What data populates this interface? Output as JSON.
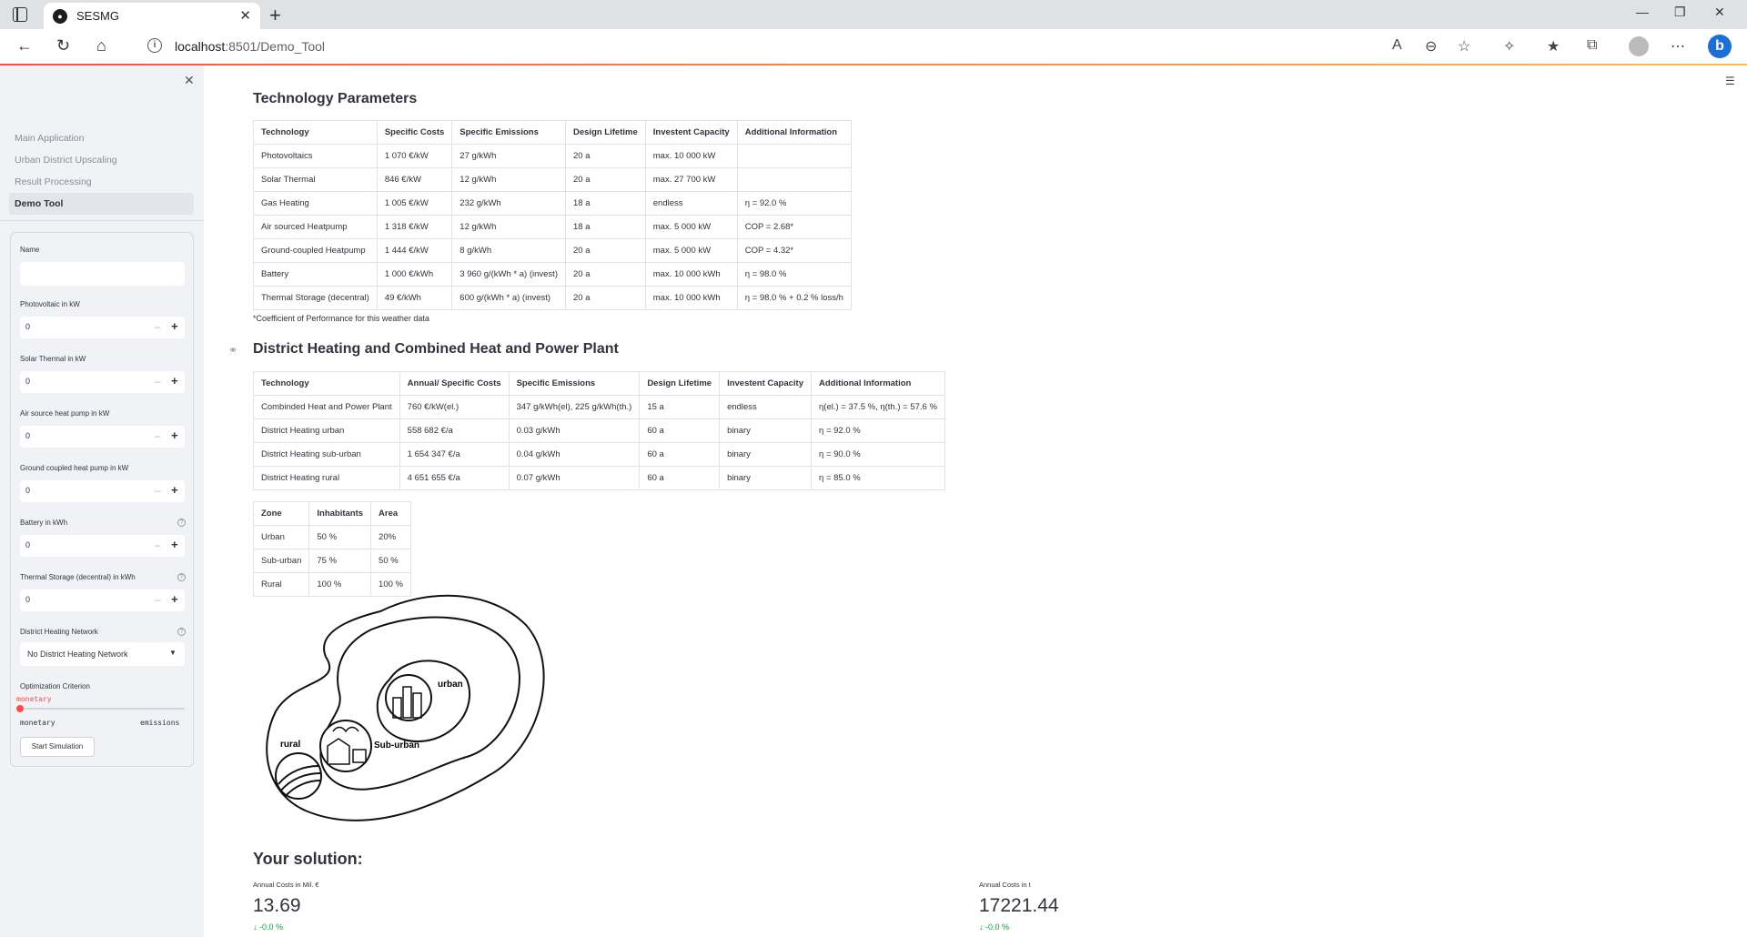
{
  "browser": {
    "tab_title": "SESMG",
    "url_host": "localhost",
    "url_rest": ":8501/Demo_Tool"
  },
  "sidebar": {
    "nav": [
      {
        "label": "Main Application"
      },
      {
        "label": "Urban District Upscaling"
      },
      {
        "label": "Result Processing"
      },
      {
        "label": "Demo Tool"
      }
    ],
    "form": {
      "name_label": "Name",
      "name_value": "",
      "pv_label": "Photovoltaic in kW",
      "pv_value": "0",
      "st_label": "Solar Thermal in kW",
      "st_value": "0",
      "ashp_label": "Air source heat pump in kW",
      "ashp_value": "0",
      "gchp_label": "Ground coupled heat pump in kW",
      "gchp_value": "0",
      "battery_label": "Battery in kWh",
      "battery_value": "0",
      "ts_label": "Thermal Storage (decentral) in kWh",
      "ts_value": "0",
      "dhn_label": "District Heating Network",
      "dhn_value": "No District Heating Network",
      "opt_label": "Optimization Criterion",
      "opt_value": "monetary",
      "opt_min": "monetary",
      "opt_max": "emissions",
      "opt_position": 0,
      "start_label": "Start Simulation"
    }
  },
  "main": {
    "tech_title": "Technology Parameters",
    "tech_table": {
      "headers": [
        "Technology",
        "Specific Costs",
        "Specific Emissions",
        "Design Lifetime",
        "Investent Capacity",
        "Additional Information"
      ],
      "rows": [
        [
          "Photovoltaics",
          "1 070 €/kW",
          "27 g/kWh",
          "20 a",
          "max. 10 000 kW",
          ""
        ],
        [
          "Solar Thermal",
          "846 €/kW",
          "12 g/kWh",
          "20 a",
          "max. 27 700 kW",
          ""
        ],
        [
          "Gas Heating",
          "1 005 €/kW",
          "232 g/kWh",
          "18 a",
          "endless",
          "η = 92.0 %"
        ],
        [
          "Air sourced Heatpump",
          "1 318 €/kW",
          "12 g/kWh",
          "18 a",
          "max. 5 000 kW",
          "COP = 2.68*"
        ],
        [
          "Ground-coupled Heatpump",
          "1 444 €/kW",
          "8 g/kWh",
          "20 a",
          "max. 5 000 kW",
          "COP = 4.32*"
        ],
        [
          "Battery",
          "1 000 €/kWh",
          "3 960 g/(kWh * a) (invest)",
          "20 a",
          "max. 10 000 kWh",
          "η = 98.0 %"
        ],
        [
          "Thermal Storage (decentral)",
          "49 €/kWh",
          "600 g/(kWh * a) (invest)",
          "20 a",
          "max. 10 000 kWh",
          "η = 98.0 % + 0.2 % loss/h"
        ]
      ]
    },
    "tech_footnote": "*Coefficient of Performance for this weather data",
    "dh_title": "District Heating and Combined Heat and Power Plant",
    "dh_table": {
      "headers": [
        "Technology",
        "Annual/ Specific Costs",
        "Specific Emissions",
        "Design Lifetime",
        "Investent Capacity",
        "Additional Information"
      ],
      "rows": [
        [
          "Combinded Heat and Power Plant",
          "760 €/kW(el.)",
          "347 g/kWh(el), 225 g/kWh(th.)",
          "15 a",
          "endless",
          "η(el.) = 37.5 %, η(th.) = 57.6 %"
        ],
        [
          "District Heating urban",
          "558 682 €/a",
          "0.03 g/kWh",
          "60 a",
          "binary",
          "η = 92.0 %"
        ],
        [
          "District Heating sub-urban",
          "1 654 347 €/a",
          "0.04 g/kWh",
          "60 a",
          "binary",
          "η = 90.0 %"
        ],
        [
          "District Heating rural",
          "4 651 655 €/a",
          "0.07 g/kWh",
          "60 a",
          "binary",
          "η = 85.0 %"
        ]
      ]
    },
    "zone_table": {
      "headers": [
        "Zone",
        "Inhabitants",
        "Area"
      ],
      "rows": [
        [
          "Urban",
          "50 %",
          "20%"
        ],
        [
          "Sub-urban",
          "75 %",
          "50 %"
        ],
        [
          "Rural",
          "100 %",
          "100 %"
        ]
      ]
    },
    "map_labels": {
      "urban": "urban",
      "suburban": "Sub-urban",
      "rural": "rural"
    },
    "solution_title": "Your solution:",
    "metrics": [
      {
        "label": "Annual Costs in Mil. €",
        "value": "13.69",
        "delta": "-0.0 %"
      },
      {
        "label": "Annual Costs in t",
        "value": "17221.44",
        "delta": "-0.0 %"
      }
    ]
  }
}
